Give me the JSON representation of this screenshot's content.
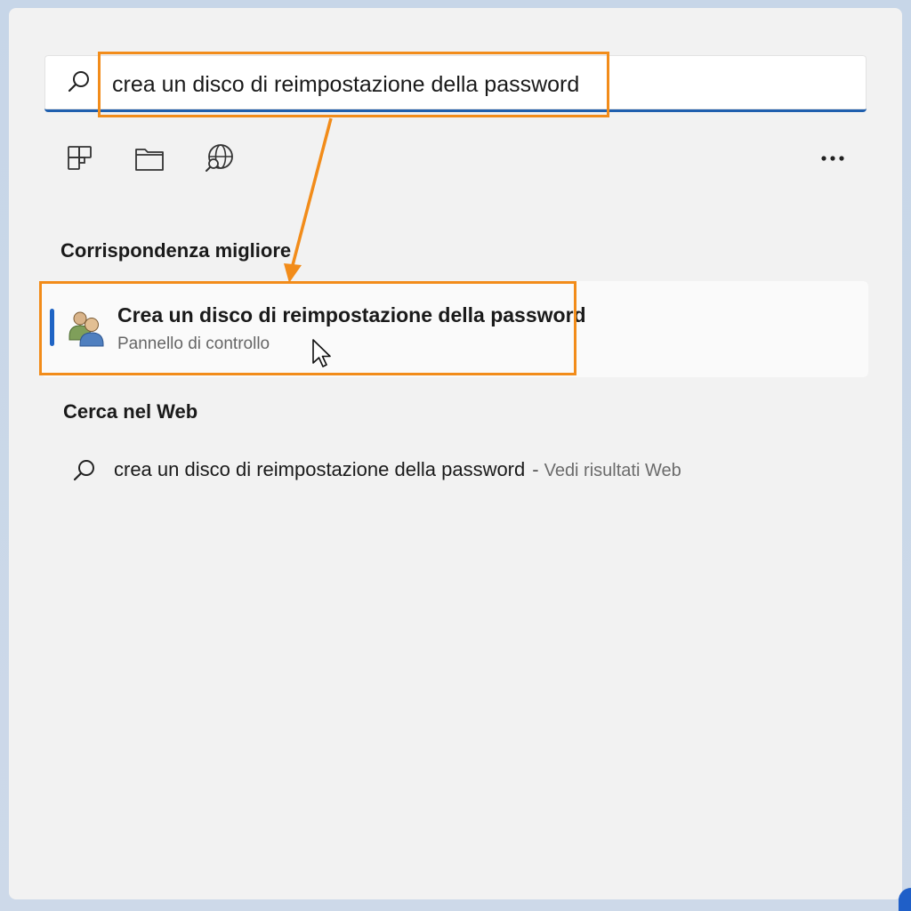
{
  "search": {
    "value": "crea un disco di reimpostazione della password",
    "icon": "search-icon"
  },
  "filters": [
    {
      "name": "apps-filter",
      "icon": "apps-grid-icon"
    },
    {
      "name": "documents-filter",
      "icon": "folder-icon"
    },
    {
      "name": "web-filter",
      "icon": "globe-search-icon"
    }
  ],
  "more": {
    "label": "..."
  },
  "best_match": {
    "section_title": "Corrispondenza migliore",
    "title": "Crea un disco di reimpostazione della password",
    "subtitle": "Pannello di controllo",
    "icon": "users-icon"
  },
  "web": {
    "section_title": "Cerca nel Web",
    "query": "crea un disco di reimpostazione della password",
    "separator": "-",
    "action": "Vedi risultati Web",
    "icon": "search-icon"
  },
  "colors": {
    "accent": "#1f5fae",
    "highlight": "#f28c1a",
    "selection_bar": "#1f64c4"
  }
}
